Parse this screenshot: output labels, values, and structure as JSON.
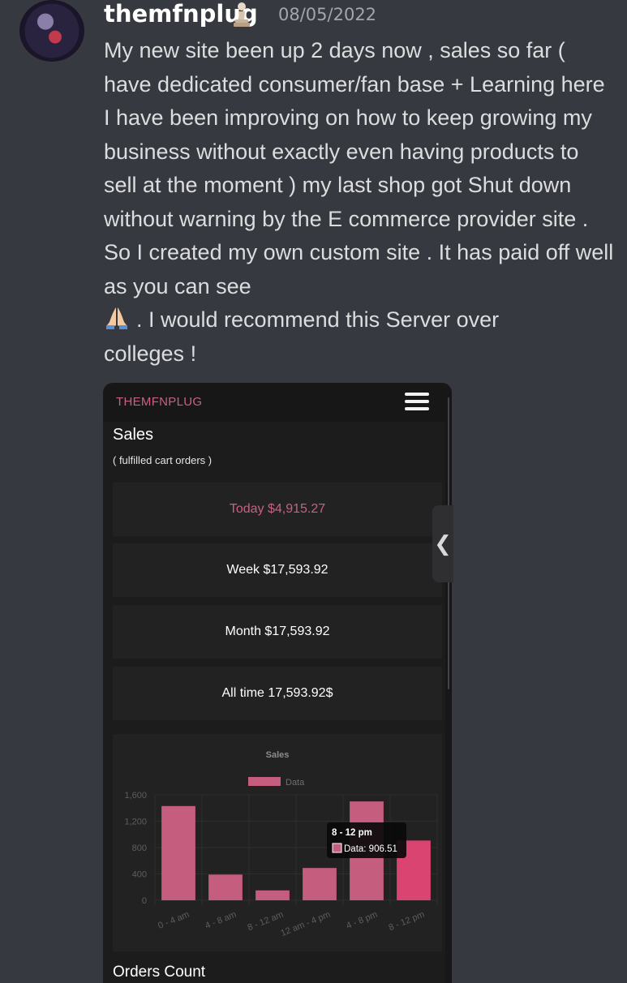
{
  "post": {
    "username": "themfnplug",
    "timestamp": "08/05/2022",
    "message_main": "My new site been up 2 days now , sales so far ( have dedicated consumer/fan base + Learning here I have been improving on how to keep growing my business without exactly even having products to sell at the moment ) my last shop got Shut down without warning by the E commerce provider site . So I created my own custom site . It has paid off well as you can see",
    "message_tail_1": ". I would recommend this Server over",
    "message_tail_2": "colleges !",
    "role_icon": "chess-pawn-icon",
    "emoji_icon": "folded-hands-icon"
  },
  "app": {
    "title": "THEMFNPLUG",
    "menu_icon": "hamburger-menu-icon",
    "heading": "Sales",
    "subheading": "( fulfilled cart orders )",
    "cards": {
      "today": "Today $4,915.27",
      "week": "Week $17,593.92",
      "month": "Month $17,593.92",
      "all_time": "All time 17,593.92$"
    },
    "next_section": "Orders Count",
    "side_tab_icon": "chevron-left-icon",
    "accent_color": "#c8617f"
  },
  "chart_data": {
    "type": "bar",
    "title": "Sales",
    "legend": [
      "Data"
    ],
    "legend_position": "top",
    "categories": [
      "0 - 4 am",
      "4 - 8 am",
      "8 - 12 am",
      "12 am - 4 pm",
      "4 - 8 pm",
      "8 - 12 pm"
    ],
    "series": [
      {
        "name": "Data",
        "values": [
          1430,
          390,
          150,
          490,
          1500,
          906.51
        ]
      }
    ],
    "ylim": [
      0,
      1600
    ],
    "yticks": [
      "0",
      "400",
      "800",
      "1,200",
      "1,600"
    ],
    "grid": true,
    "bar_color": "#c45d7e",
    "highlight_color": "#d94470",
    "tooltip": {
      "title": "8 - 12 pm",
      "label": "Data: 906.51"
    }
  }
}
